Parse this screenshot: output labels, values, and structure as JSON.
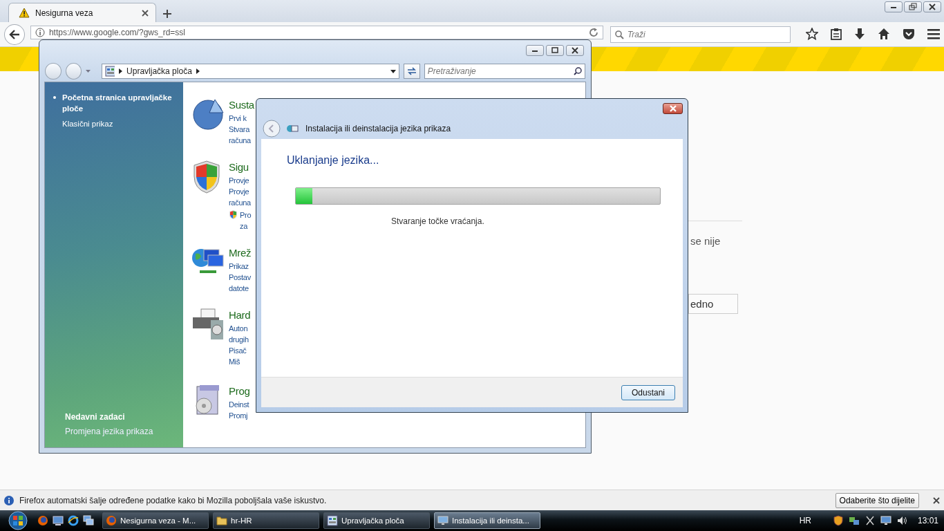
{
  "browser": {
    "tabs": [
      {
        "title": "Nesigurna veza",
        "selected": true
      }
    ],
    "url": "https://www.google.com/?gws_rd=ssl",
    "search": {
      "placeholder": "Traži"
    }
  },
  "page": {
    "text": "se nije",
    "button": "edno"
  },
  "control_panel": {
    "breadcrumb": "Upravljačka ploča",
    "search": {
      "placeholder": "Pretraživanje"
    },
    "sidebar": {
      "items": [
        {
          "text": "Početna stranica upravljačke ploče",
          "selected": true
        },
        {
          "text": "Klasični prikaz",
          "selected": false
        }
      ]
    },
    "recent": {
      "title": "Nedavni zadaci",
      "items": [
        "Promjena jezika prikaza"
      ]
    },
    "categories": [
      {
        "kind": "pie",
        "title": "Susta",
        "links": [
          "Prvi k",
          "Stvara",
          "računa"
        ]
      },
      {
        "kind": "shield",
        "title": "Sigu",
        "links": [
          "Provje",
          "Provje",
          "računa"
        ],
        "shield_link": [
          "Pro",
          "za"
        ]
      },
      {
        "kind": "network",
        "title": "Mrež",
        "links": [
          "Prikaz",
          "Postav",
          "datote"
        ]
      },
      {
        "kind": "printer",
        "title": "Hard",
        "links": [
          "Auton",
          "drugih",
          "Pisač",
          "Miš"
        ]
      },
      {
        "kind": "programs",
        "title": "Prog",
        "links": [
          "Deinst",
          "Promj"
        ]
      }
    ]
  },
  "dialog": {
    "title": "Instalacija ili deinstalacija jezika prikaza",
    "heading": "Uklanjanje jezika...",
    "progress": {
      "level": 0.045
    },
    "status": "Stvaranje točke vraćanja.",
    "buttons": [
      "Odustani"
    ]
  },
  "notification": {
    "text": "Firefox automatski šalje određene podatke kako bi Mozilla poboljšala vaše iskustvo.",
    "button": "Odaberite što dijelite"
  },
  "taskbar": {
    "tasks": [
      {
        "kind": "firefox",
        "label": "Nesigurna veza - M...",
        "selected": false
      },
      {
        "kind": "folder",
        "label": "hr-HR",
        "selected": false
      },
      {
        "kind": "control-panel",
        "label": "Upravljačka ploča",
        "selected": false
      },
      {
        "kind": "dialog",
        "label": "Instalacija ili deinsta...",
        "selected": true
      }
    ],
    "tray": {
      "language": "HR",
      "clock": "13:01"
    }
  }
}
